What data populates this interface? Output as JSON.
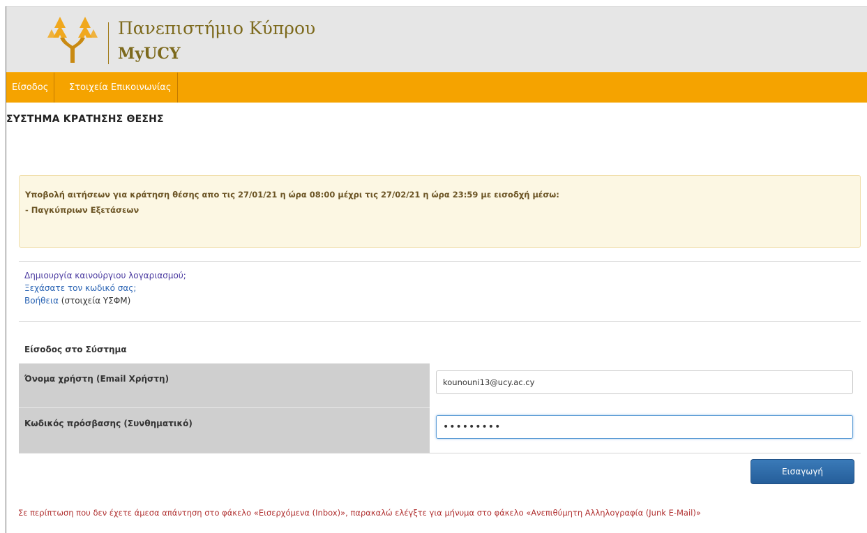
{
  "header": {
    "logo_icon": "cypress-trees-logo-icon",
    "title_line1": "Πανεπιστήμιο Κύπρου",
    "title_line2": "MyUCY"
  },
  "nav": {
    "items": [
      {
        "label": "Είσοδος"
      },
      {
        "label": "Στοιχεία Επικοινωνίας"
      }
    ]
  },
  "page": {
    "title": "ΣΥΣΤΗΜΑ ΚΡΑΤΗΣΗΣ ΘΕΣΗΣ"
  },
  "alert": {
    "line1": "Υποβολή αιτήσεων για κράτηση θέσης απο τις 27/01/21 η ώρα 08:00 μέχρι τις 27/02/21 η ώρα 23:59 με εισοδχή μέσω:",
    "line2": "- Παγκύπριων Εξετάσεων"
  },
  "links": {
    "create_account": "Δημιουργία καινούργιου λογαριασμού;",
    "forgot_password": "Ξεχάσατε τον κωδικό σας;",
    "help": "Βοήθεια",
    "help_note": " (στοιχεία ΥΣΦΜ)"
  },
  "login": {
    "section_title": "Είσοδος στο Σύστημα",
    "username_label": "Όνομα χρήστη (Email Χρήστη)",
    "username_value": "kounouni13@ucy.ac.cy",
    "password_label": "Κωδικός πρόσβασης (Συνθηματικό)",
    "password_value": "•••••••••",
    "submit_label": "Εισαγωγή"
  },
  "footer": {
    "note": "Σε περίπτωση που δεν έχετε άμεσα απάντηση στο φάκελο «Εισερχόμενα (Inbox)», παρακαλώ ελέγξτε για μήνυμα στο φάκελο «Ανεπιθύμητη Αλληλογραφία (Junk E-Mail)»"
  },
  "colors": {
    "nav_bg": "#f5a300",
    "header_bg": "#e6e6e6",
    "logo_text": "#7d6a1d",
    "alert_bg": "#fcf7e3",
    "button_bg": "#2d6aa6",
    "footer_text": "#b03030"
  }
}
